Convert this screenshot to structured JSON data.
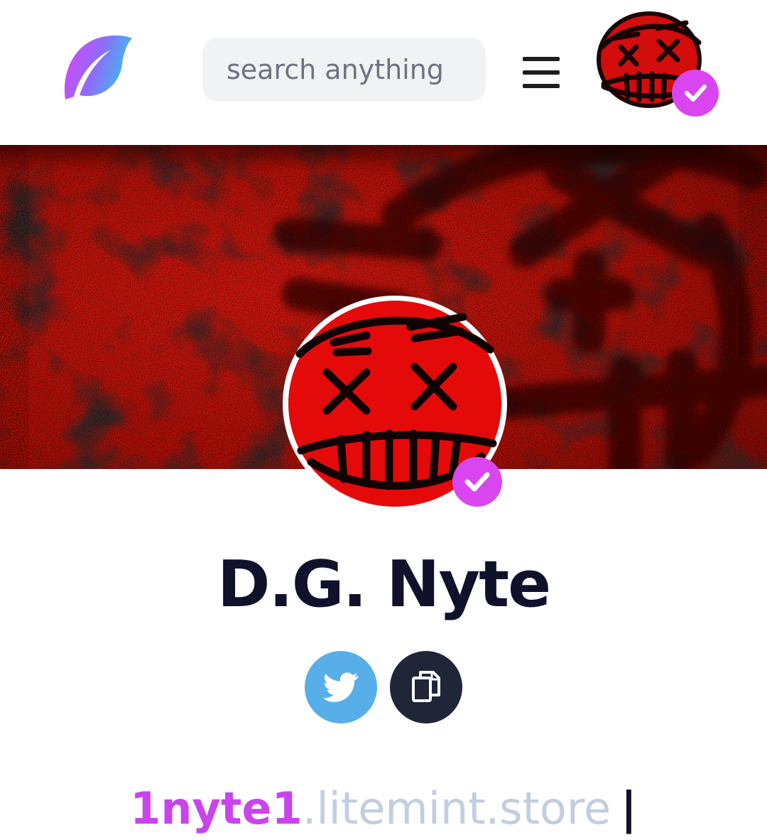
{
  "header": {
    "logo_icon": "leaf-logo-icon",
    "search": {
      "placeholder": "search anything",
      "value": ""
    },
    "menu_icon": "hamburger-menu-icon",
    "avatar_icon": "red-face-avatar",
    "verified_icon": "check-badge-icon"
  },
  "banner": {
    "image": "red-splatter-face-banner"
  },
  "profile": {
    "name": "D.G. Nyte",
    "avatar_icon": "red-face-avatar",
    "verified_icon": "check-badge-icon",
    "socials": [
      {
        "name": "twitter",
        "icon": "twitter-icon"
      },
      {
        "name": "copy",
        "icon": "copy-icon"
      }
    ],
    "store": {
      "username": "1nyte1",
      "domain": ".litemint.store",
      "cursor": "|"
    }
  },
  "colors": {
    "accent": "#d946ef",
    "brand_purple": "#c943ef",
    "twitter_blue": "#58aee9",
    "dark_button": "#202638",
    "title_text": "#10112a",
    "banner_red": "#c4140f"
  }
}
